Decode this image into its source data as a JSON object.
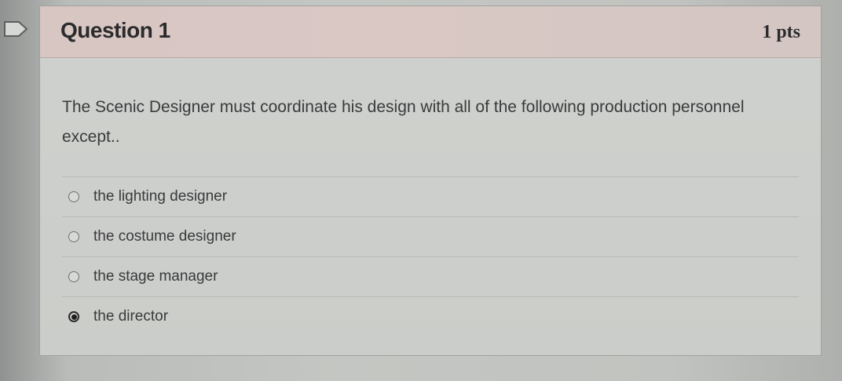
{
  "question": {
    "title": "Question 1",
    "points": "1 pts",
    "text": "The Scenic Designer must coordinate his design with all of the following production personnel except..",
    "answers": [
      {
        "label": "the lighting designer",
        "selected": false
      },
      {
        "label": "the costume designer",
        "selected": false
      },
      {
        "label": "the stage manager",
        "selected": false
      },
      {
        "label": "the director",
        "selected": true
      }
    ]
  },
  "icons": {
    "flag": "flag-icon",
    "radio": "radio-button"
  }
}
